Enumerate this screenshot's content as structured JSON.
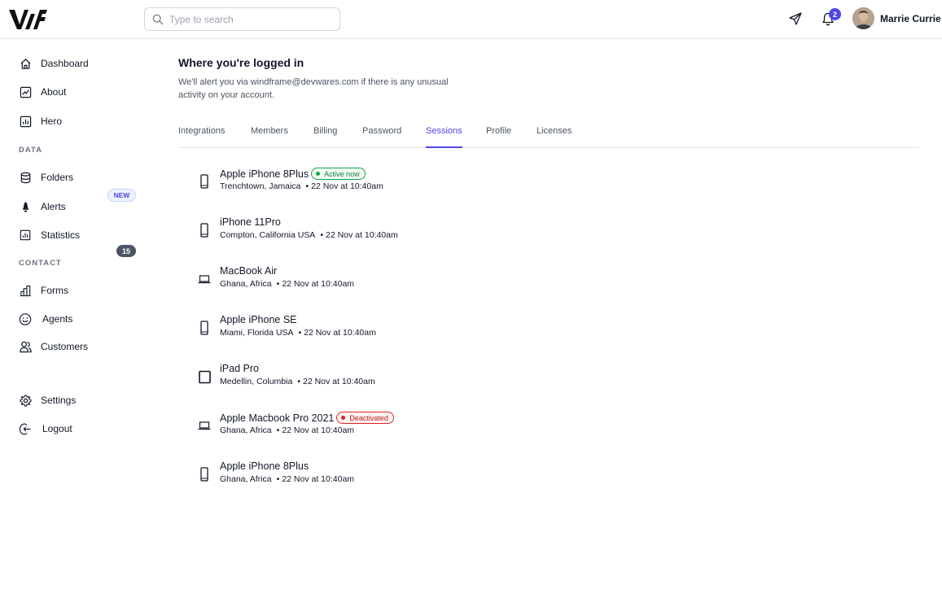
{
  "header": {
    "search_placeholder": "Type to search",
    "notification_count": "2",
    "user_name": "Marrie Currie"
  },
  "sidebar": {
    "items": [
      {
        "label": "Dashboard",
        "icon": "home-icon"
      },
      {
        "label": "About",
        "icon": "chart-line-icon"
      },
      {
        "label": "Hero",
        "icon": "bar-chart-icon"
      }
    ],
    "data_section": "DATA",
    "data_items": [
      {
        "label": "Folders",
        "icon": "database-icon"
      },
      {
        "label": "Alerts",
        "icon": "bell-icon"
      },
      {
        "label": "Statistics",
        "icon": "statistics-icon",
        "badge": "NEW"
      }
    ],
    "contact_section": "CONTACT",
    "contact_items": [
      {
        "label": "Forms",
        "icon": "bar-chart-icon",
        "badge": "15"
      },
      {
        "label": "Agents",
        "icon": "smiley-icon"
      },
      {
        "label": "Customers",
        "icon": "users-icon"
      }
    ],
    "bottom_items": [
      {
        "label": "Settings",
        "icon": "gear-icon"
      },
      {
        "label": "Logout",
        "icon": "logout-icon"
      }
    ]
  },
  "main": {
    "title": "Where you're logged in",
    "description": "We'll alert you via windframe@devwares.com if there is any unusual activity on your account.",
    "tabs": [
      "Integrations",
      "Members",
      "Billing",
      "Password",
      "Sessions",
      "Profile",
      "Licenses"
    ],
    "active_tab": "Sessions",
    "sessions": [
      {
        "device": "Apple iPhone 8Plus",
        "type": "phone",
        "location": "Trenchtown, Jamaica",
        "time": "22 Nov at 10:40am",
        "status": "Active now"
      },
      {
        "device": "iPhone 11Pro",
        "type": "phone",
        "location": "Compton, California USA",
        "time": "22 Nov at 10:40am"
      },
      {
        "device": "MacBook Air",
        "type": "laptop",
        "location": "Ghana, Africa",
        "time": "22 Nov at 10:40am"
      },
      {
        "device": "Apple iPhone SE",
        "type": "phone",
        "location": "Miami, Florida USA",
        "time": "22 Nov at 10:40am"
      },
      {
        "device": "iPad Pro",
        "type": "tablet",
        "location": "Medellin, Columbia",
        "time": "22 Nov at 10:40am"
      },
      {
        "device": "Apple Macbook Pro 2021",
        "type": "laptop",
        "location": "Ghana, Africa",
        "time": "22 Nov at 10:40am",
        "status": "Deactivated"
      },
      {
        "device": "Apple iPhone 8Plus",
        "type": "phone",
        "location": "Ghana, Africa",
        "time": "22 Nov at 10:40am"
      }
    ],
    "separator": "•"
  },
  "colors": {
    "accent": "#4f46e5",
    "active_status": "#16a34a",
    "deactivated_status": "#dc2626"
  }
}
